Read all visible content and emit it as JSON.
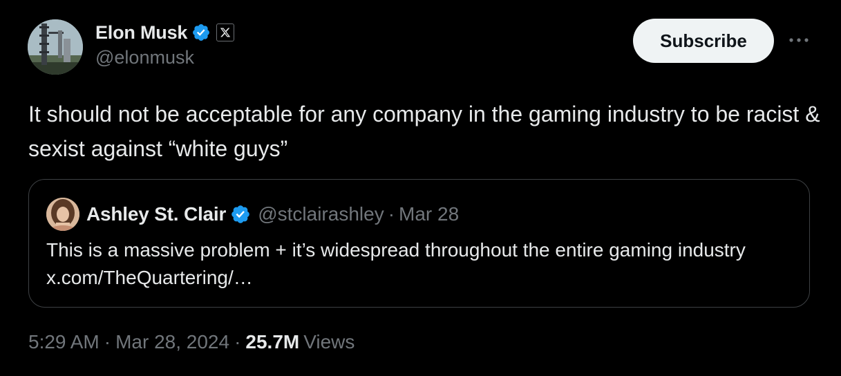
{
  "author": {
    "display_name": "Elon Musk",
    "handle": "@elonmusk",
    "verified": true,
    "affiliation_icon": "x-logo-icon"
  },
  "actions": {
    "subscribe_label": "Subscribe",
    "more_label": "···"
  },
  "tweet": {
    "text": "It should not be acceptable for any company in the gaming industry to be racist & sexist against “white guys”"
  },
  "quoted_tweet": {
    "display_name": "Ashley St. Clair",
    "handle": "@stclairashley",
    "separator": "·",
    "date": "Mar 28",
    "text": "This is a massive problem + it’s widespread throughout the entire gaming industry x.com/TheQuartering/…"
  },
  "meta": {
    "time": "5:29 AM",
    "separator": "·",
    "date": "Mar 28, 2024",
    "views_count": "25.7M",
    "views_label": "Views"
  },
  "colors": {
    "background": "#000000",
    "text_primary": "#e7e9ea",
    "text_secondary": "#71767b",
    "verified_blue": "#1d9bf0",
    "button_bg": "#eff3f4",
    "border": "#3e4144"
  }
}
